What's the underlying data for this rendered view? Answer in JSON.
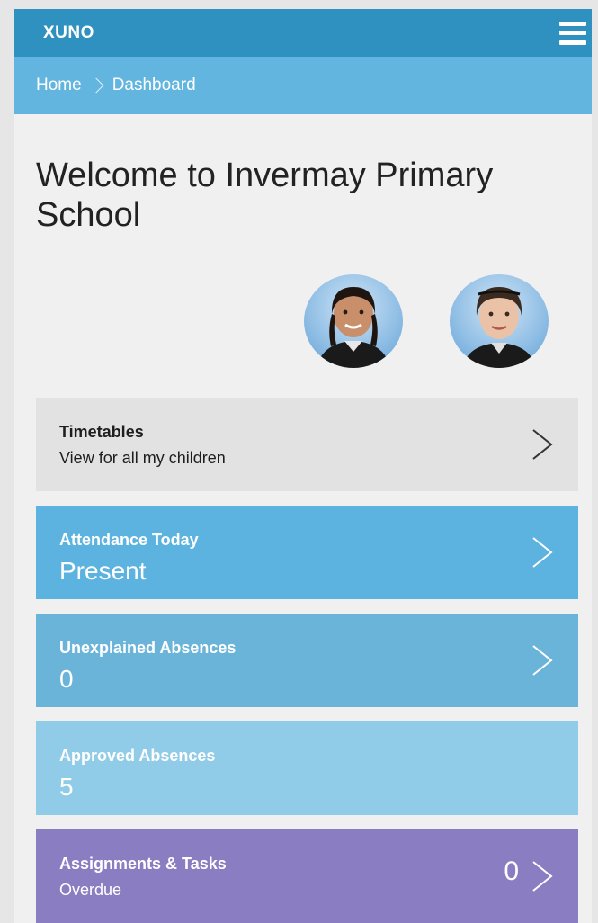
{
  "app": {
    "brand": "XUNO"
  },
  "breadcrumb": {
    "home": "Home",
    "current": "Dashboard"
  },
  "welcome": {
    "title": "Welcome to Invermay Primary School"
  },
  "children": [
    {
      "icon": "child-avatar-photo"
    },
    {
      "icon": "child-avatar-photo"
    }
  ],
  "cards": {
    "timetables": {
      "title": "Timetables",
      "subtitle": "View for all my children"
    },
    "attendance": {
      "title": "Attendance Today",
      "value": "Present"
    },
    "unexplained": {
      "title": "Unexplained Absences",
      "value": "0"
    },
    "approved": {
      "title": "Approved Absences",
      "value": "5"
    },
    "assignments": {
      "title": "Assignments & Tasks",
      "subtitle": "Overdue",
      "count": "0"
    }
  },
  "colors": {
    "topbar": "#2f91c0",
    "breadcrumb": "#62b5df",
    "timetables": "#e2e2e2",
    "attendance": "#5cb3df",
    "unexplained": "#6ab4d9",
    "approved": "#90cbe8",
    "assignments": "#8a7dc2"
  }
}
